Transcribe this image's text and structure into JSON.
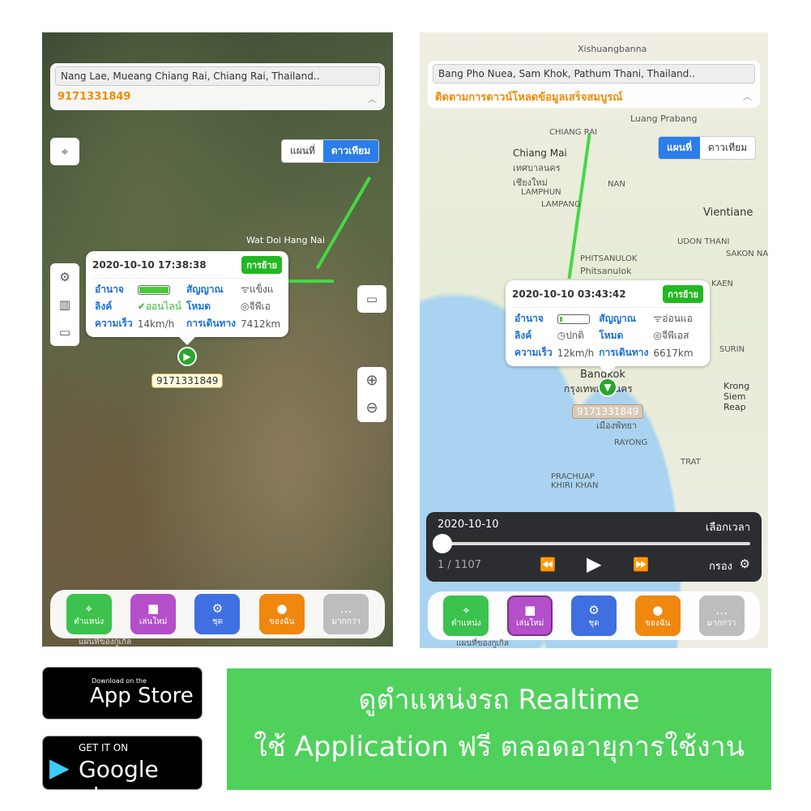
{
  "left": {
    "address": "Nang Lae, Mueang Chiang Rai, Chiang Rai, Thailand..",
    "subtitle": "9171331849",
    "map_toggle": [
      "แผนที่",
      "ดาวเทียม"
    ],
    "active_toggle": "ดาวเทียม",
    "place_label": "Wat Doi Hang Nai",
    "popup": {
      "datetime": "2020-10-10 17:38:38",
      "badge": "การย้าย",
      "rows": [
        [
          "อำนาจ",
          "",
          "สัญญาณ",
          "แข็งแ"
        ],
        [
          "ลิงค์",
          "ออนไลน์",
          "โหมด",
          "จีพีเอ"
        ],
        [
          "ความเร็ว",
          "14km/h",
          "การเดินทาง",
          "7412km"
        ]
      ],
      "battery_level": 1.0
    },
    "plate": "9171331849",
    "google_text": "แผนที่ของกูเกิล"
  },
  "right": {
    "address": "Bang Pho Nuea, Sam Khok, Pathum Thani, Thailand..",
    "subtitle": "ติดตามการดาวน์โหลดข้อมูลเสร็จสมบูรณ์",
    "map_toggle": [
      "แผนที่",
      "ดาวเทียม"
    ],
    "active_toggle": "แผนที่",
    "map_labels": [
      "Xishuangbanna",
      "CHIANG RAI",
      "Chiang Mai",
      "เทศบาลนคร เชียงใหม่",
      "LAMPHUN",
      "LAMPANG",
      "NAN",
      "Vientiane",
      "UDON THANI",
      "PHITSANULOK",
      "Phitsanulok",
      "SAKON NA",
      "KAEN",
      "Bangkok",
      "กรุงเทพมหานคร",
      "เมืองพัทยา",
      "RAYONG",
      "PRACHUAP KHIRI KHAN",
      "SURIN",
      "Krong Siem Reap",
      "TRAT",
      "Luang Prabang"
    ],
    "popup": {
      "datetime": "2020-10-10 03:43:42",
      "badge": "การย้าย",
      "rows": [
        [
          "อำนาจ",
          "",
          "สัญญาณ",
          "อ่อนแอ"
        ],
        [
          "ลิงค์",
          "ปกติ",
          "โหมด",
          "จีพีเอส"
        ],
        [
          "ความเร็ว",
          "12km/h",
          "การเดินทาง",
          "6617km"
        ]
      ],
      "battery_level": 0.1
    },
    "plate": "9171331849",
    "player": {
      "date": "2020-10-10",
      "choose_time": "เลือกเวลา",
      "counter": "1 / 1107",
      "filter": "กรอง",
      "progress": 0
    },
    "google_text": "แผนที่ของกูเกิล"
  },
  "bottom_bar": [
    {
      "label": "ตำแหน่ง",
      "icon": "location-pin-icon",
      "color": "#3cc24e"
    },
    {
      "label": "เล่นใหม่",
      "icon": "video-icon",
      "color": "#b24fc9"
    },
    {
      "label": "ชุด",
      "icon": "gear-icon",
      "color": "#3f6fe0"
    },
    {
      "label": "ของฉัน",
      "icon": "person-icon",
      "color": "#f0870f"
    },
    {
      "label": "มากกว่า",
      "icon": "more-icon",
      "color": "#bdbdbd"
    }
  ],
  "stores": {
    "apple_small": "Download on the",
    "apple_big": "App Store",
    "google_small": "GET IT ON",
    "google_big": "Google play"
  },
  "banner": {
    "line1": "ดูตำแหน่งรถ Realtime",
    "line2": "ใช้ Application ฟรี ตลอดอายุการใช้งาน"
  }
}
